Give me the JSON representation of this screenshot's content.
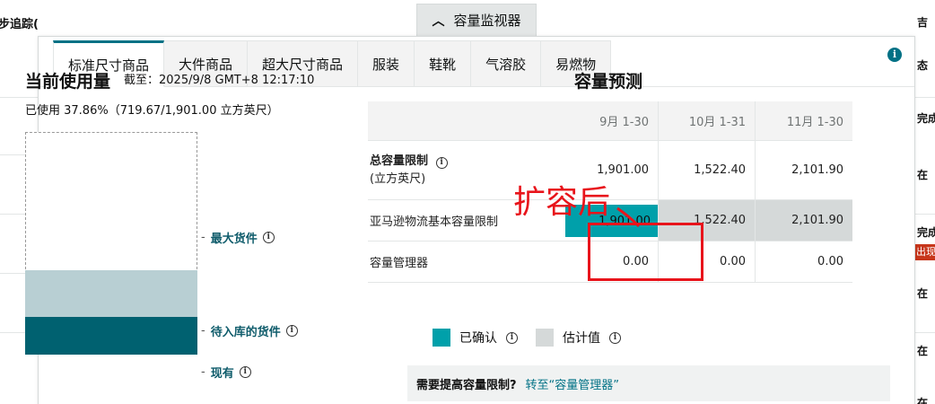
{
  "background": {
    "left_text": "步追踪(",
    "right_cells": [
      "吉",
      "态",
      "完成",
      "在",
      "完成",
      "出现",
      "在",
      "在",
      "在"
    ]
  },
  "monitor_toggle": {
    "label": "容量监视器"
  },
  "tabs": [
    "标准尺寸商品",
    "大件商品",
    "超大尺寸商品",
    "服装",
    "鞋靴",
    "气溶胶",
    "易燃物"
  ],
  "usage": {
    "title": "当前使用量",
    "as_of": "截至：2025/9/8 GMT+8 12:17:10",
    "used_text": "已使用 37.86%（719.67/1,901.00 立方英尺）",
    "labels": {
      "max": "最大货件",
      "inbound": "待入库的货件",
      "onhand": "现有"
    },
    "levels": {
      "inbound_fraction": 0.21,
      "onhand_fraction": 0.17
    }
  },
  "forecast": {
    "title": "容量预测",
    "columns": [
      "9月 1-30",
      "10月 1-31",
      "11月 1-30"
    ],
    "rows": [
      {
        "label": "总容量限制",
        "sublabel": "(立方英尺)",
        "values": [
          "1,901.00",
          "1,522.40",
          "2,101.90"
        ]
      },
      {
        "label": "亚马逊物流基本容量限制",
        "values": [
          "1,901.00",
          "1,522.40",
          "2,101.90"
        ]
      },
      {
        "label": "容量管理器",
        "values": [
          "0.00",
          "0.00",
          "0.00"
        ]
      }
    ],
    "annotation": "扩容后",
    "legend": {
      "confirmed": "已确认",
      "estimated": "估计值"
    },
    "need_more": {
      "question": "需要提高容量限制?",
      "link": "转至“容量管理器”"
    }
  },
  "colors": {
    "accent": "#007185",
    "confirmed": "#00a0aa",
    "estimated": "#d5d9d9",
    "onhand": "#006170",
    "inbound": "#b8cfd3",
    "annotation": "#e8141b"
  }
}
